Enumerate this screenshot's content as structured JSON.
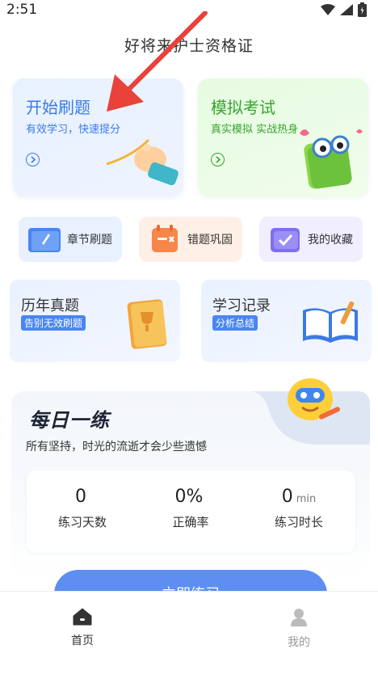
{
  "status": {
    "time": "2:51"
  },
  "app_title": "好将来护士资格证",
  "start_card": {
    "title": "开始刷题",
    "subtitle": "有效学习，快速提分"
  },
  "mock_card": {
    "title": "模拟考试",
    "subtitle": "真实模拟 实战热身"
  },
  "small_cards": [
    {
      "label": "章节刷题"
    },
    {
      "label": "错题巩固"
    },
    {
      "label": "我的收藏"
    }
  ],
  "history_card": {
    "title": "历年真题",
    "tag": "告别无效刷题"
  },
  "record_card": {
    "title": "学习记录",
    "tag": "分析总结"
  },
  "daily": {
    "title": "每日一练",
    "subtitle": "所有坚持，时光的流逝才会少些遗憾",
    "stats": [
      {
        "value": "0",
        "unit": "",
        "label": "练习天数"
      },
      {
        "value": "0%",
        "unit": "",
        "label": "正确率"
      },
      {
        "value": "0",
        "unit": "min",
        "label": "练习时长"
      }
    ],
    "button": "立即练习"
  },
  "tabs": [
    {
      "label": "首页",
      "icon": "home-icon"
    },
    {
      "label": "我的",
      "icon": "profile-icon"
    }
  ],
  "colors": {
    "blue": "#3a79e8",
    "green": "#37a52c",
    "button": "#5d8ef2",
    "arrow": "#e8423a"
  }
}
